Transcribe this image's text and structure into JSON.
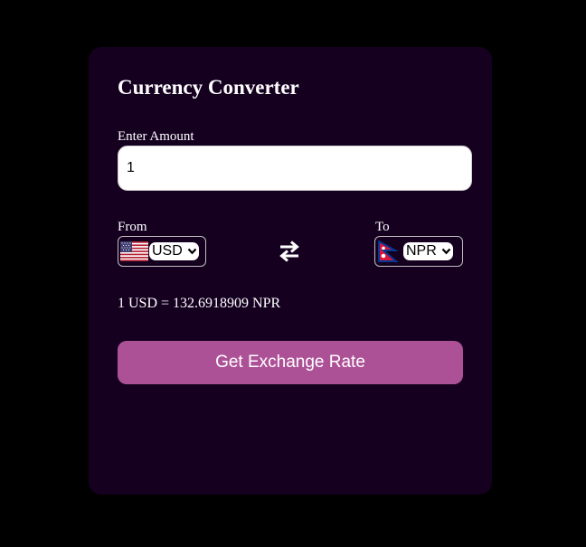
{
  "app": {
    "title": "Currency Converter"
  },
  "amount": {
    "label": "Enter Amount",
    "value": "1"
  },
  "from": {
    "label": "From",
    "currency": "USD",
    "flag_icon": "us-flag-icon"
  },
  "to": {
    "label": "To",
    "currency": "NPR",
    "flag_icon": "nepal-flag-icon"
  },
  "swap_icon": "swap-arrows-icon",
  "rate_text": "1 USD = 132.6918909 NPR",
  "button": {
    "label": "Get Exchange Rate"
  },
  "colors": {
    "page_background": "#000000",
    "card_background": "#150020",
    "button_background": "#ad5197",
    "text": "#ffffff"
  }
}
